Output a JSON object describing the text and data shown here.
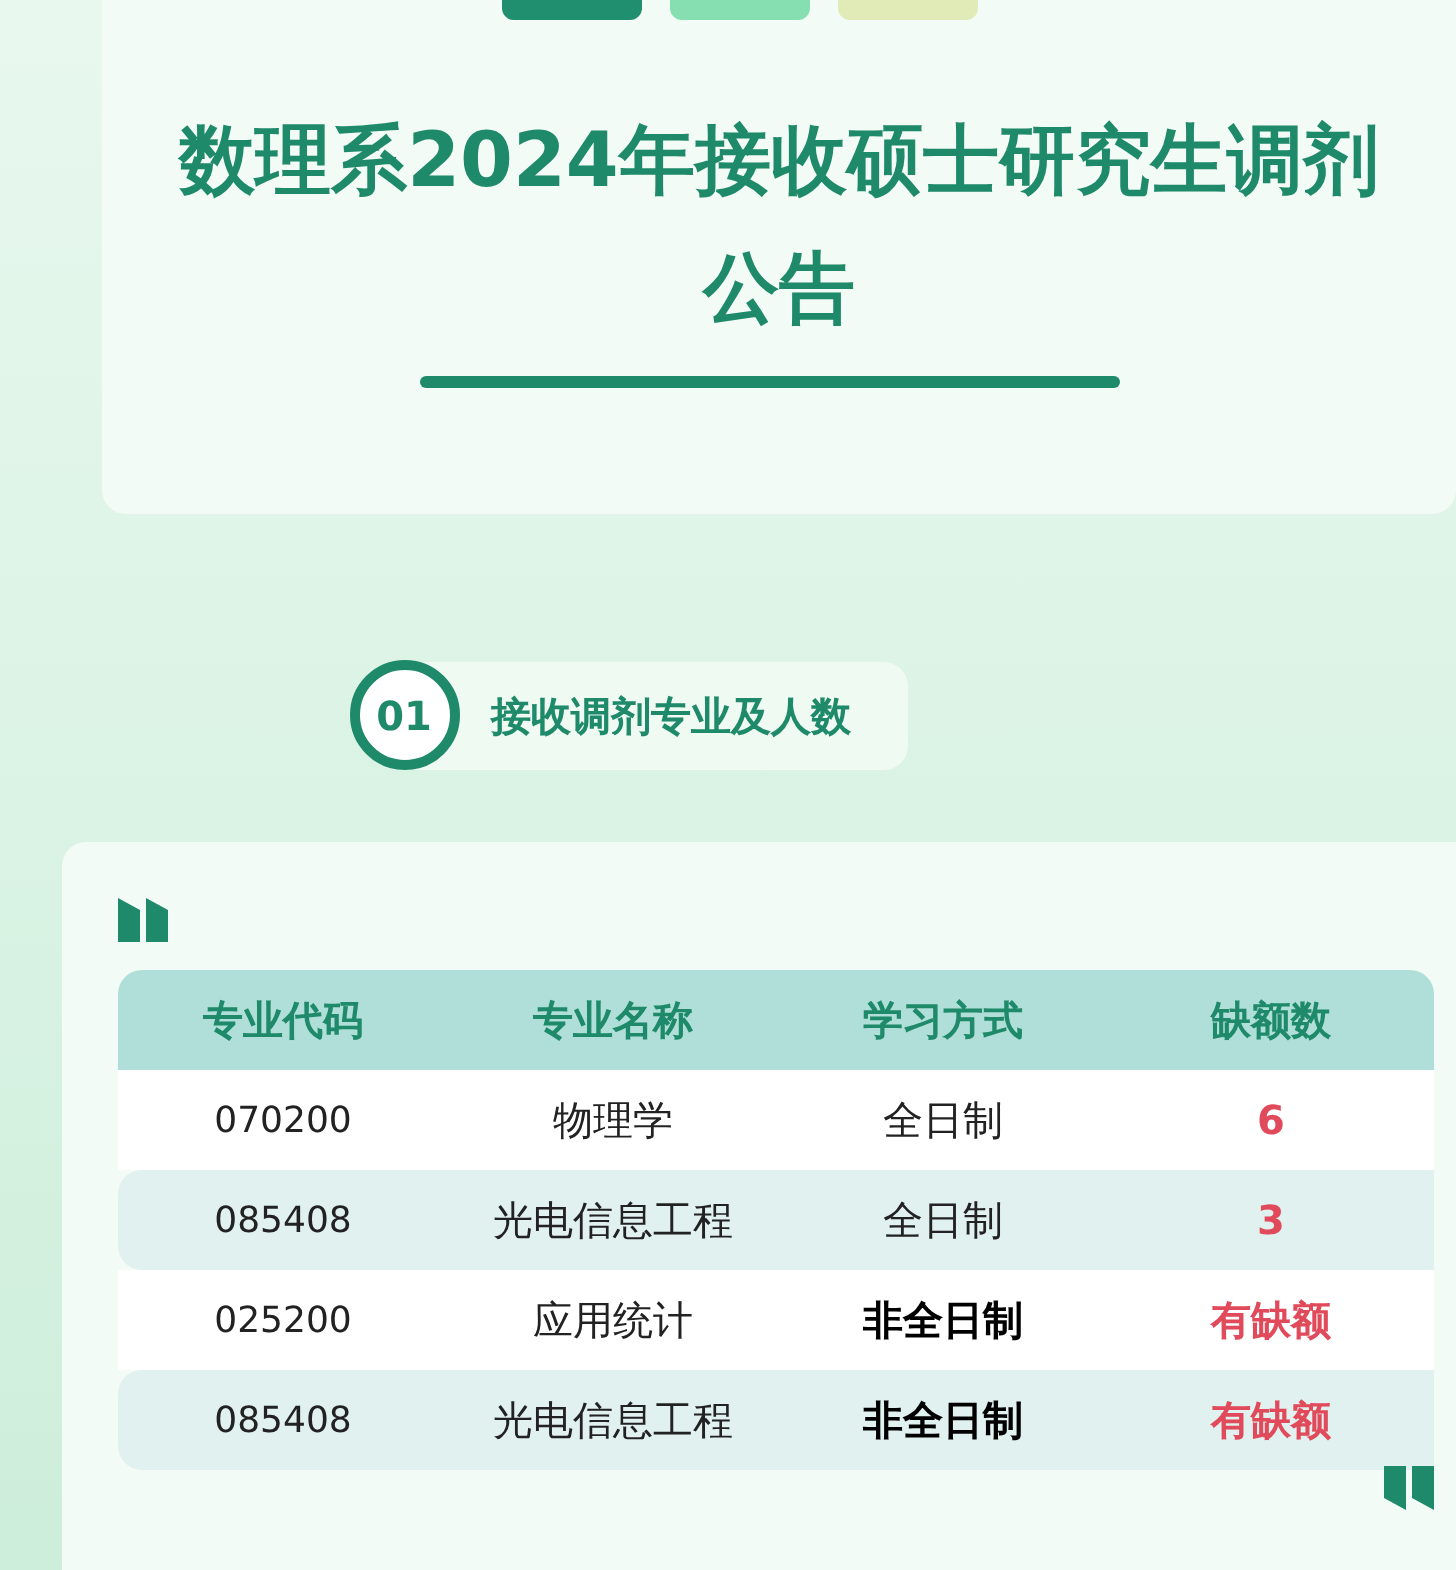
{
  "header": {
    "title_lines": [
      "数理系2024年接收硕士研究生调剂",
      "公告"
    ]
  },
  "section": {
    "number": "01",
    "title": "接收调剂专业及人数"
  },
  "table": {
    "columns": [
      "专业代码",
      "专业名称",
      "学习方式",
      "缺额数"
    ],
    "rows": [
      {
        "code": "070200",
        "name": "物理学",
        "mode": "全日制",
        "mode_emphasized": false,
        "vacancy": "6"
      },
      {
        "code": "085408",
        "name": "光电信息工程",
        "mode": "全日制",
        "mode_emphasized": false,
        "vacancy": "3"
      },
      {
        "code": "025200",
        "name": "应用统计",
        "mode": "非全日制",
        "mode_emphasized": true,
        "vacancy": "有缺额"
      },
      {
        "code": "085408",
        "name": "光电信息工程",
        "mode": "非全日制",
        "mode_emphasized": true,
        "vacancy": "有缺额"
      }
    ]
  }
}
